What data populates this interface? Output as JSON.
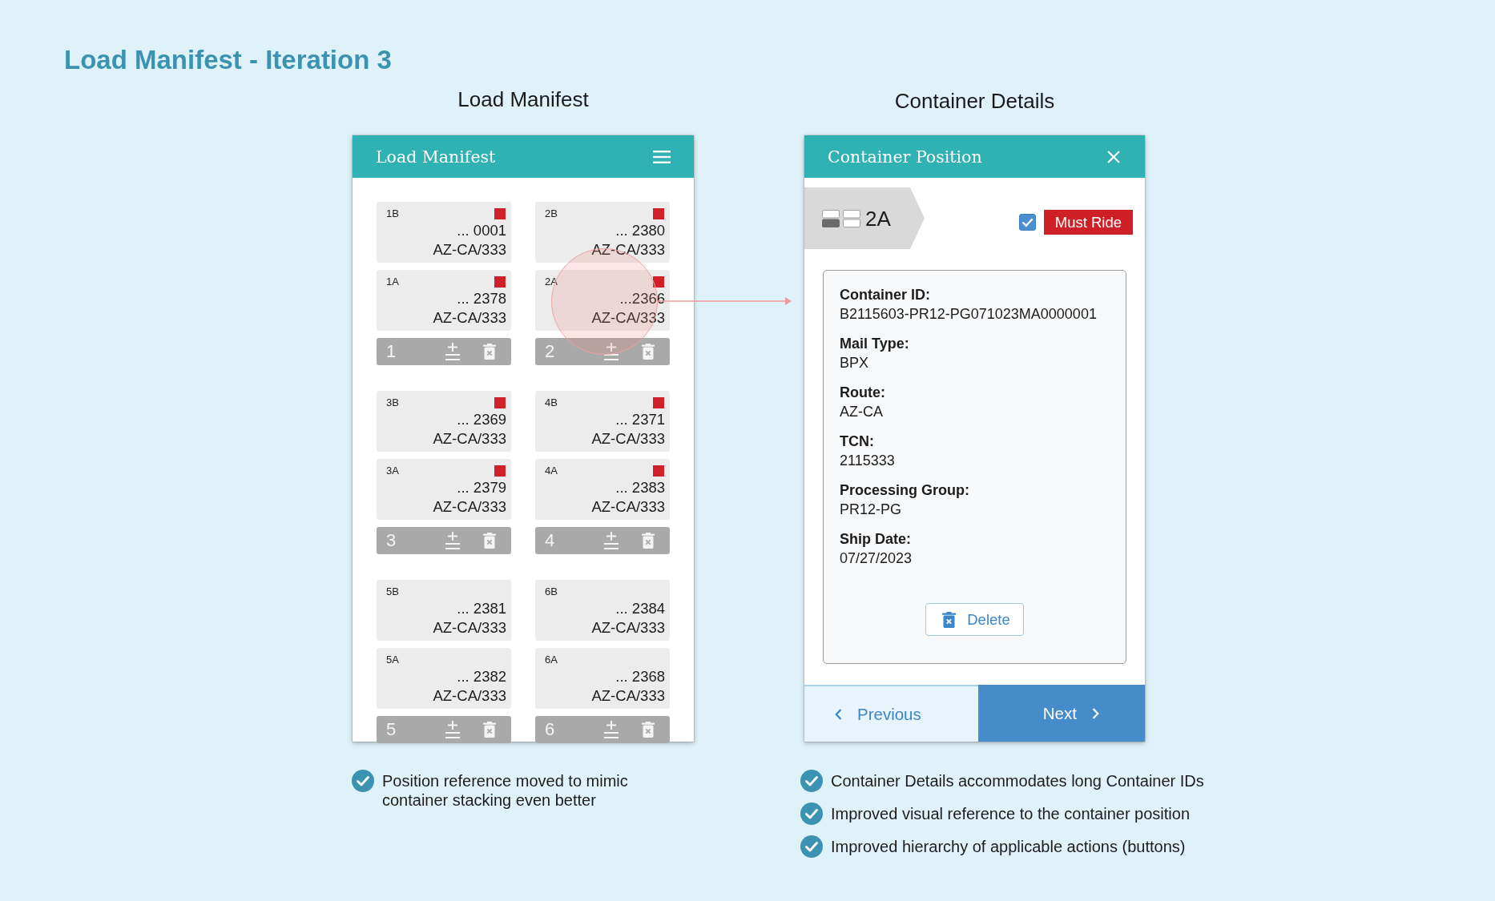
{
  "page": {
    "title": "Load Manifest - Iteration 3"
  },
  "manifest_screen": {
    "caption": "Load Manifest",
    "header_title": "Load Manifest",
    "stacks": [
      {
        "number": "1",
        "containers": [
          {
            "position": "1B",
            "number": "... 0001",
            "route": "AZ-CA/333",
            "flagged": true,
            "highlighted": false
          },
          {
            "position": "1A",
            "number": "... 2378",
            "route": "AZ-CA/333",
            "flagged": true,
            "highlighted": false
          }
        ]
      },
      {
        "number": "2",
        "containers": [
          {
            "position": "2B",
            "number": "... 2380",
            "route": "AZ-CA/333",
            "flagged": true,
            "highlighted": false
          },
          {
            "position": "2A",
            "number": "...2366",
            "route": "AZ-CA/333",
            "flagged": true,
            "highlighted": true
          }
        ]
      },
      {
        "number": "3",
        "containers": [
          {
            "position": "3B",
            "number": "... 2369",
            "route": "AZ-CA/333",
            "flagged": true,
            "highlighted": false
          },
          {
            "position": "3A",
            "number": "... 2379",
            "route": "AZ-CA/333",
            "flagged": true,
            "highlighted": false
          }
        ]
      },
      {
        "number": "4",
        "containers": [
          {
            "position": "4B",
            "number": "... 2371",
            "route": "AZ-CA/333",
            "flagged": true,
            "highlighted": false
          },
          {
            "position": "4A",
            "number": "... 2383",
            "route": "AZ-CA/333",
            "flagged": true,
            "highlighted": false
          }
        ]
      },
      {
        "number": "5",
        "containers": [
          {
            "position": "5B",
            "number": "... 2381",
            "route": "AZ-CA/333",
            "flagged": false,
            "highlighted": false
          },
          {
            "position": "5A",
            "number": "... 2382",
            "route": "AZ-CA/333",
            "flagged": false,
            "highlighted": false
          }
        ]
      },
      {
        "number": "6",
        "containers": [
          {
            "position": "6B",
            "number": "... 2384",
            "route": "AZ-CA/333",
            "flagged": false,
            "highlighted": false
          },
          {
            "position": "6A",
            "number": "... 2368",
            "route": "AZ-CA/333",
            "flagged": false,
            "highlighted": false
          }
        ]
      }
    ],
    "notes": [
      "Position reference moved to mimic container stacking even better"
    ]
  },
  "details_screen": {
    "caption": "Container Details",
    "header_title": "Container Position",
    "position": "2A",
    "must_ride": {
      "checked": true,
      "label": "Must Ride"
    },
    "fields": [
      {
        "label": "Container ID:",
        "value": "B2115603-PR12-PG071023MA0000001"
      },
      {
        "label": "Mail Type:",
        "value": "BPX"
      },
      {
        "label": "Route:",
        "value": "AZ-CA"
      },
      {
        "label": "TCN:",
        "value": "2115333"
      },
      {
        "label": "Processing Group:",
        "value": "PR12-PG"
      },
      {
        "label": "Ship Date:",
        "value": "07/27/2023"
      }
    ],
    "delete_button": "Delete",
    "previous_button": "Previous",
    "next_button": "Next",
    "notes": [
      "Container Details accommodates long Container IDs",
      "Improved visual reference to the container position",
      "Improved hierarchy of applicable actions (buttons)"
    ]
  }
}
